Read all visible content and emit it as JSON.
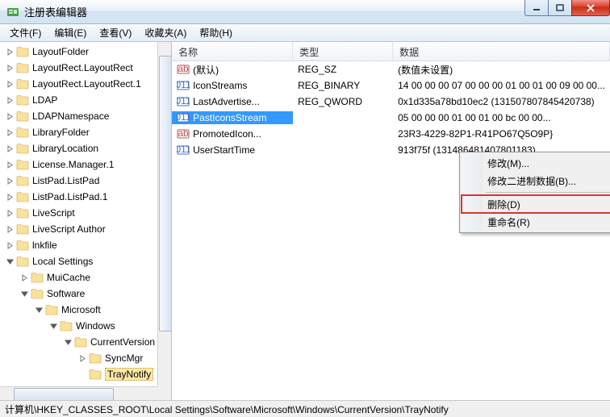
{
  "window": {
    "title": "注册表编辑器"
  },
  "menu": {
    "file": "文件(F)",
    "edit": "编辑(E)",
    "view": "查看(V)",
    "fav": "收藏夹(A)",
    "help": "帮助(H)"
  },
  "tree": {
    "items": [
      {
        "indent": 0,
        "exp": "closed",
        "label": "LayoutFolder"
      },
      {
        "indent": 0,
        "exp": "closed",
        "label": "LayoutRect.LayoutRect"
      },
      {
        "indent": 0,
        "exp": "closed",
        "label": "LayoutRect.LayoutRect.1"
      },
      {
        "indent": 0,
        "exp": "closed",
        "label": "LDAP"
      },
      {
        "indent": 0,
        "exp": "closed",
        "label": "LDAPNamespace"
      },
      {
        "indent": 0,
        "exp": "closed",
        "label": "LibraryFolder"
      },
      {
        "indent": 0,
        "exp": "closed",
        "label": "LibraryLocation"
      },
      {
        "indent": 0,
        "exp": "closed",
        "label": "License.Manager.1"
      },
      {
        "indent": 0,
        "exp": "closed",
        "label": "ListPad.ListPad"
      },
      {
        "indent": 0,
        "exp": "closed",
        "label": "ListPad.ListPad.1"
      },
      {
        "indent": 0,
        "exp": "closed",
        "label": "LiveScript"
      },
      {
        "indent": 0,
        "exp": "closed",
        "label": "LiveScript Author"
      },
      {
        "indent": 0,
        "exp": "closed",
        "label": "lnkfile"
      },
      {
        "indent": 0,
        "exp": "open",
        "label": "Local Settings"
      },
      {
        "indent": 1,
        "exp": "closed",
        "label": "MuiCache"
      },
      {
        "indent": 1,
        "exp": "open",
        "label": "Software"
      },
      {
        "indent": 2,
        "exp": "open",
        "label": "Microsoft"
      },
      {
        "indent": 3,
        "exp": "open",
        "label": "Windows"
      },
      {
        "indent": 4,
        "exp": "open",
        "label": "CurrentVersion"
      },
      {
        "indent": 5,
        "exp": "closed",
        "label": "SyncMgr"
      },
      {
        "indent": 5,
        "exp": "none",
        "label": "TrayNotify",
        "selected": true
      }
    ]
  },
  "list": {
    "headers": {
      "name": "名称",
      "type": "类型",
      "data": "数据"
    },
    "rows": [
      {
        "icon": "ab",
        "name": "(默认)",
        "type": "REG_SZ",
        "data": "(数值未设置)"
      },
      {
        "icon": "bin",
        "name": "IconStreams",
        "type": "REG_BINARY",
        "data": "14 00 00 00 07 00 00 00 01 00 01 00 09 00 00..."
      },
      {
        "icon": "bin",
        "name": "LastAdvertise...",
        "type": "REG_QWORD",
        "data": "0x1d335a78bd10ec2 (131507807845420738)"
      },
      {
        "icon": "bin",
        "name": "PastIconsStream",
        "type": "",
        "data": "05 00 00 00 01 00 01 00 bc 00 00...",
        "selected": true
      },
      {
        "icon": "ab",
        "name": "PromotedIcon...",
        "type": "",
        "data": "23R3-4229-82P1-R41PO67Q5O9P}"
      },
      {
        "icon": "bin",
        "name": "UserStartTime",
        "type": "",
        "data": "913f75f (131486481407801183)"
      }
    ]
  },
  "contextmenu": {
    "modify": "修改(M)...",
    "modifybin": "修改二进制数据(B)...",
    "delete": "删除(D)",
    "rename": "重命名(R)"
  },
  "statusbar": {
    "path": "计算机\\HKEY_CLASSES_ROOT\\Local Settings\\Software\\Microsoft\\Windows\\CurrentVersion\\TrayNotify"
  }
}
